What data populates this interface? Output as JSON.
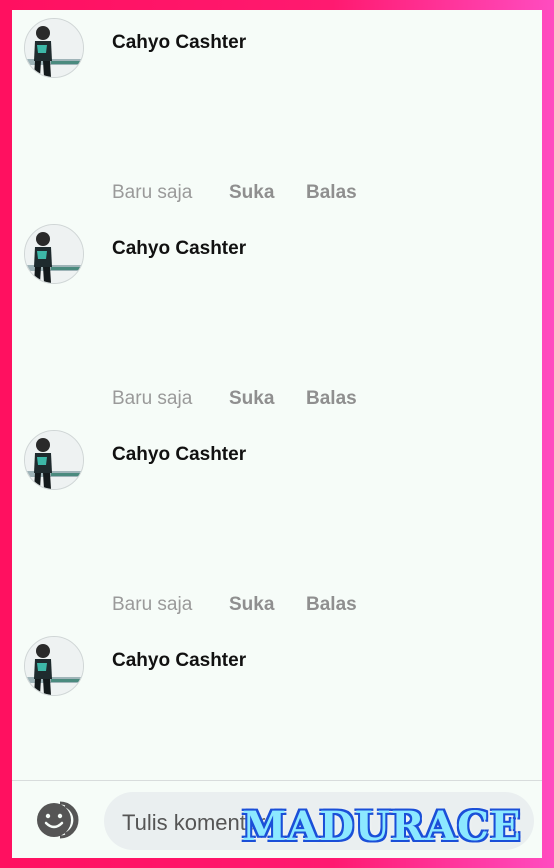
{
  "comments": [
    {
      "author": "Cahyo Cashter",
      "time": "Baru saja",
      "like_label": "Suka",
      "reply_label": "Balas"
    },
    {
      "author": "Cahyo Cashter",
      "time": "Baru saja",
      "like_label": "Suka",
      "reply_label": "Balas"
    },
    {
      "author": "Cahyo Cashter",
      "time": "Baru saja",
      "like_label": "Suka",
      "reply_label": "Balas"
    },
    {
      "author": "Cahyo Cashter"
    }
  ],
  "composer": {
    "placeholder": "Tulis komentar...",
    "emoji_icon": "emoji-icon"
  },
  "watermark": "MADURACE",
  "colors": {
    "frame": "#ff1a6e",
    "background": "#f6fcf8",
    "muted_text": "#9a9a9a",
    "name_text": "#111111"
  }
}
